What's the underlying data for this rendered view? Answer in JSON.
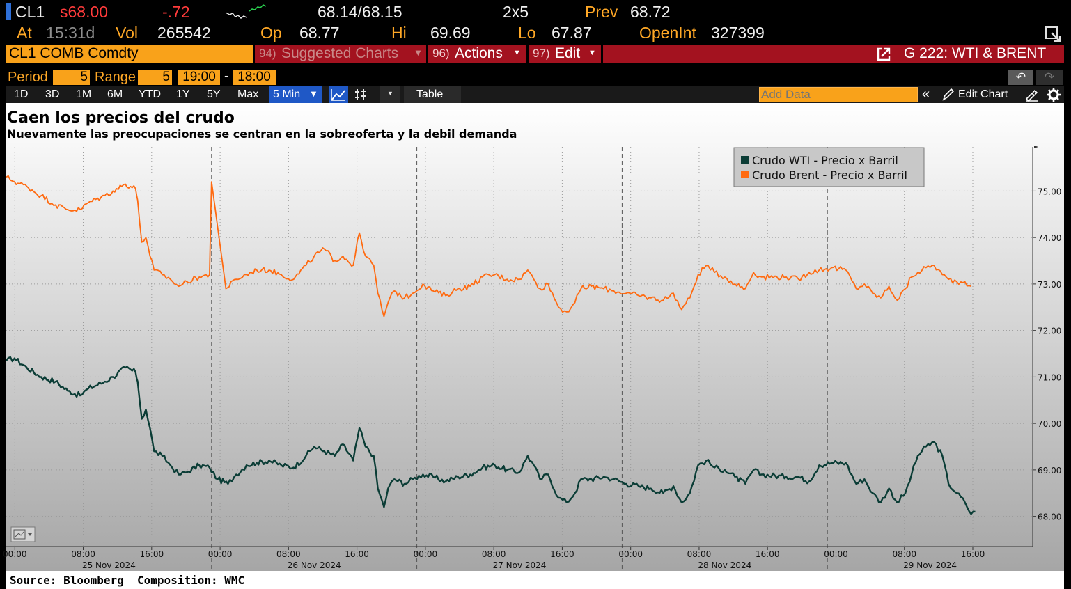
{
  "quote": {
    "ticker": "CL1",
    "last": "s68.00",
    "change": "-.72",
    "bid_ask": "68.14/68.15",
    "size": "2x5",
    "prev_label": "Prev",
    "prev": "68.72",
    "time_label": "At",
    "time": "15:31d",
    "vol_label": "Vol",
    "vol": "265542",
    "open_label": "Op",
    "open": "68.77",
    "high_label": "Hi",
    "high": "69.69",
    "low_label": "Lo",
    "low": "67.87",
    "oi_label": "OpenInt",
    "oi": "327399"
  },
  "command_bar": {
    "security": "CL1 COMB Comdty",
    "suggested_num": "94)",
    "suggested": "Suggested Charts",
    "actions_num": "96)",
    "actions": "Actions",
    "edit_num": "97)",
    "edit": "Edit",
    "function_title": "G 222: WTI & BRENT"
  },
  "range_bar": {
    "period_label": "Period",
    "period_value": "5",
    "range_label": "Range",
    "range_value": "5",
    "time_from": "19:00",
    "dash": "-",
    "time_to": "18:00"
  },
  "toolbar": {
    "periods": [
      "1D",
      "3D",
      "1M",
      "6M",
      "YTD",
      "1Y",
      "5Y",
      "Max"
    ],
    "interval": "5 Min",
    "table": "Table",
    "add_data_placeholder": "Add Data",
    "edit_chart": "Edit Chart"
  },
  "colors": {
    "wti": "#0b3d36",
    "brent": "#ff6a10",
    "accent": "#f9a21a",
    "command_bar": "#a3121f"
  },
  "chart_data": {
    "type": "line",
    "title": "Caen los precios del crudo",
    "subtitle": "Nuevamente las preocupaciones se centran en la sobreoferta y la debil demanda",
    "source": "Source: Bloomberg  Composition: WMC",
    "ylim": [
      67.35,
      75.95
    ],
    "yticks": [
      "75.00",
      "74.00",
      "73.00",
      "72.00",
      "71.00",
      "70.00",
      "69.00",
      "68.00"
    ],
    "xlim": [
      0,
      5
    ],
    "xticks": [
      {
        "t": 0.0417,
        "label": "00:00"
      },
      {
        "t": 0.375,
        "label": "08:00"
      },
      {
        "t": 0.7083,
        "label": "16:00"
      },
      {
        "t": 1.0417,
        "label": "00:00"
      },
      {
        "t": 1.375,
        "label": "08:00"
      },
      {
        "t": 1.7083,
        "label": "16:00"
      },
      {
        "t": 2.0417,
        "label": "00:00"
      },
      {
        "t": 2.375,
        "label": "08:00"
      },
      {
        "t": 2.7083,
        "label": "16:00"
      },
      {
        "t": 3.0417,
        "label": "00:00"
      },
      {
        "t": 3.375,
        "label": "08:00"
      },
      {
        "t": 3.7083,
        "label": "16:00"
      },
      {
        "t": 4.0417,
        "label": "00:00"
      },
      {
        "t": 4.375,
        "label": "08:00"
      },
      {
        "t": 4.7083,
        "label": "16:00"
      }
    ],
    "date_labels": [
      {
        "t": 0.5,
        "label": "25 Nov 2024"
      },
      {
        "t": 1.5,
        "label": "26 Nov 2024"
      },
      {
        "t": 2.5,
        "label": "27 Nov 2024"
      },
      {
        "t": 3.5,
        "label": "28 Nov 2024"
      },
      {
        "t": 4.5,
        "label": "29 Nov 2024"
      }
    ],
    "series": [
      {
        "name": "Crudo WTI - Precio x Barril",
        "color": "#0b3d36",
        "points": [
          [
            0,
            71.35
          ],
          [
            0.04,
            71.4
          ],
          [
            0.1,
            71.2
          ],
          [
            0.17,
            71.0
          ],
          [
            0.24,
            70.9
          ],
          [
            0.3,
            70.7
          ],
          [
            0.36,
            70.6
          ],
          [
            0.4,
            70.75
          ],
          [
            0.48,
            70.9
          ],
          [
            0.52,
            71.0
          ],
          [
            0.58,
            71.2
          ],
          [
            0.63,
            71.1
          ],
          [
            0.64,
            70.9
          ],
          [
            0.66,
            70.1
          ],
          [
            0.68,
            70.3
          ],
          [
            0.7,
            69.9
          ],
          [
            0.72,
            69.4
          ],
          [
            0.76,
            69.3
          ],
          [
            0.8,
            69.1
          ],
          [
            0.84,
            68.9
          ],
          [
            0.88,
            68.95
          ],
          [
            0.94,
            69.1
          ],
          [
            0.99,
            69.05
          ],
          [
            1.03,
            68.8
          ],
          [
            1.08,
            68.7
          ],
          [
            1.12,
            68.9
          ],
          [
            1.17,
            69.1
          ],
          [
            1.22,
            69.15
          ],
          [
            1.28,
            69.2
          ],
          [
            1.34,
            69.1
          ],
          [
            1.4,
            69.05
          ],
          [
            1.46,
            69.3
          ],
          [
            1.5,
            69.5
          ],
          [
            1.55,
            69.4
          ],
          [
            1.6,
            69.3
          ],
          [
            1.64,
            69.55
          ],
          [
            1.69,
            69.2
          ],
          [
            1.72,
            69.9
          ],
          [
            1.75,
            69.5
          ],
          [
            1.79,
            69.3
          ],
          [
            1.81,
            68.6
          ],
          [
            1.84,
            68.2
          ],
          [
            1.86,
            68.6
          ],
          [
            1.89,
            68.8
          ],
          [
            1.94,
            68.7
          ],
          [
            1.98,
            68.8
          ],
          [
            2.03,
            68.9
          ],
          [
            2.08,
            68.85
          ],
          [
            2.14,
            68.75
          ],
          [
            2.2,
            68.85
          ],
          [
            2.26,
            68.9
          ],
          [
            2.32,
            69.05
          ],
          [
            2.38,
            69.1
          ],
          [
            2.44,
            69.0
          ],
          [
            2.5,
            68.95
          ],
          [
            2.54,
            69.3
          ],
          [
            2.57,
            69.1
          ],
          [
            2.6,
            68.8
          ],
          [
            2.64,
            68.9
          ],
          [
            2.69,
            68.4
          ],
          [
            2.73,
            68.3
          ],
          [
            2.77,
            68.5
          ],
          [
            2.8,
            68.8
          ],
          [
            2.85,
            68.8
          ],
          [
            2.91,
            68.85
          ],
          [
            2.96,
            68.8
          ],
          [
            3.02,
            68.7
          ],
          [
            3.08,
            68.65
          ],
          [
            3.14,
            68.6
          ],
          [
            3.2,
            68.5
          ],
          [
            3.25,
            68.65
          ],
          [
            3.29,
            68.3
          ],
          [
            3.33,
            68.5
          ],
          [
            3.37,
            69.1
          ],
          [
            3.41,
            69.2
          ],
          [
            3.45,
            69.05
          ],
          [
            3.5,
            69.0
          ],
          [
            3.55,
            68.85
          ],
          [
            3.6,
            68.7
          ],
          [
            3.64,
            69.0
          ],
          [
            3.68,
            68.9
          ],
          [
            3.8,
            68.85
          ],
          [
            3.86,
            68.85
          ],
          [
            3.91,
            68.75
          ],
          [
            3.96,
            69.1
          ],
          [
            4.02,
            69.15
          ],
          [
            4.09,
            69.15
          ],
          [
            4.14,
            68.7
          ],
          [
            4.18,
            68.8
          ],
          [
            4.22,
            68.5
          ],
          [
            4.26,
            68.3
          ],
          [
            4.3,
            68.6
          ],
          [
            4.34,
            68.3
          ],
          [
            4.38,
            68.5
          ],
          [
            4.41,
            68.9
          ],
          [
            4.44,
            69.3
          ],
          [
            4.48,
            69.5
          ],
          [
            4.52,
            69.6
          ],
          [
            4.56,
            69.3
          ],
          [
            4.59,
            68.7
          ],
          [
            4.63,
            68.5
          ],
          [
            4.67,
            68.3
          ],
          [
            4.7,
            68.05
          ],
          [
            4.72,
            68.1
          ]
        ]
      },
      {
        "name": "Crudo Brent - Precio x Barril",
        "color": "#ff6a10",
        "points": [
          [
            0,
            75.3
          ],
          [
            0.04,
            75.2
          ],
          [
            0.1,
            75.1
          ],
          [
            0.17,
            74.9
          ],
          [
            0.24,
            74.7
          ],
          [
            0.3,
            74.6
          ],
          [
            0.36,
            74.6
          ],
          [
            0.4,
            74.75
          ],
          [
            0.48,
            74.9
          ],
          [
            0.52,
            75.0
          ],
          [
            0.58,
            75.15
          ],
          [
            0.63,
            75.05
          ],
          [
            0.64,
            74.8
          ],
          [
            0.66,
            73.9
          ],
          [
            0.68,
            74.0
          ],
          [
            0.7,
            73.6
          ],
          [
            0.72,
            73.3
          ],
          [
            0.76,
            73.2
          ],
          [
            0.8,
            73.1
          ],
          [
            0.84,
            72.95
          ],
          [
            0.88,
            73.05
          ],
          [
            0.94,
            73.15
          ],
          [
            0.99,
            73.2
          ],
          [
            1.0,
            75.2
          ],
          [
            1.07,
            72.9
          ],
          [
            1.12,
            73.1
          ],
          [
            1.17,
            73.2
          ],
          [
            1.22,
            73.3
          ],
          [
            1.28,
            73.3
          ],
          [
            1.34,
            73.2
          ],
          [
            1.4,
            73.1
          ],
          [
            1.46,
            73.4
          ],
          [
            1.5,
            73.6
          ],
          [
            1.55,
            73.75
          ],
          [
            1.6,
            73.5
          ],
          [
            1.64,
            73.6
          ],
          [
            1.69,
            73.4
          ],
          [
            1.72,
            74.1
          ],
          [
            1.75,
            73.6
          ],
          [
            1.79,
            73.4
          ],
          [
            1.81,
            72.8
          ],
          [
            1.84,
            72.3
          ],
          [
            1.86,
            72.6
          ],
          [
            1.89,
            72.85
          ],
          [
            1.94,
            72.7
          ],
          [
            1.98,
            72.8
          ],
          [
            2.03,
            73.0
          ],
          [
            2.08,
            72.85
          ],
          [
            2.14,
            72.75
          ],
          [
            2.2,
            72.9
          ],
          [
            2.26,
            72.95
          ],
          [
            2.32,
            73.15
          ],
          [
            2.38,
            73.2
          ],
          [
            2.44,
            73.1
          ],
          [
            2.5,
            73.1
          ],
          [
            2.54,
            73.3
          ],
          [
            2.57,
            73.1
          ],
          [
            2.6,
            72.9
          ],
          [
            2.64,
            73.0
          ],
          [
            2.69,
            72.5
          ],
          [
            2.73,
            72.4
          ],
          [
            2.77,
            72.6
          ],
          [
            2.8,
            72.9
          ],
          [
            2.85,
            72.95
          ],
          [
            2.91,
            72.9
          ],
          [
            2.96,
            72.85
          ],
          [
            3.02,
            72.8
          ],
          [
            3.08,
            72.75
          ],
          [
            3.14,
            72.7
          ],
          [
            3.2,
            72.65
          ],
          [
            3.25,
            72.8
          ],
          [
            3.29,
            72.45
          ],
          [
            3.33,
            72.7
          ],
          [
            3.37,
            73.2
          ],
          [
            3.41,
            73.4
          ],
          [
            3.45,
            73.25
          ],
          [
            3.5,
            73.15
          ],
          [
            3.55,
            73.0
          ],
          [
            3.6,
            72.9
          ],
          [
            3.64,
            73.25
          ],
          [
            3.68,
            73.15
          ],
          [
            3.8,
            73.15
          ],
          [
            3.86,
            73.1
          ],
          [
            3.91,
            73.25
          ],
          [
            3.96,
            73.3
          ],
          [
            4.02,
            73.35
          ],
          [
            4.09,
            73.3
          ],
          [
            4.14,
            72.9
          ],
          [
            4.18,
            73.0
          ],
          [
            4.22,
            72.8
          ],
          [
            4.26,
            72.7
          ],
          [
            4.3,
            72.95
          ],
          [
            4.34,
            72.65
          ],
          [
            4.38,
            72.9
          ],
          [
            4.41,
            73.15
          ],
          [
            4.44,
            73.25
          ],
          [
            4.48,
            73.35
          ],
          [
            4.52,
            73.4
          ],
          [
            4.56,
            73.2
          ],
          [
            4.59,
            73.1
          ],
          [
            4.63,
            73.05
          ],
          [
            4.67,
            73.05
          ],
          [
            4.7,
            72.95
          ]
        ]
      }
    ]
  }
}
